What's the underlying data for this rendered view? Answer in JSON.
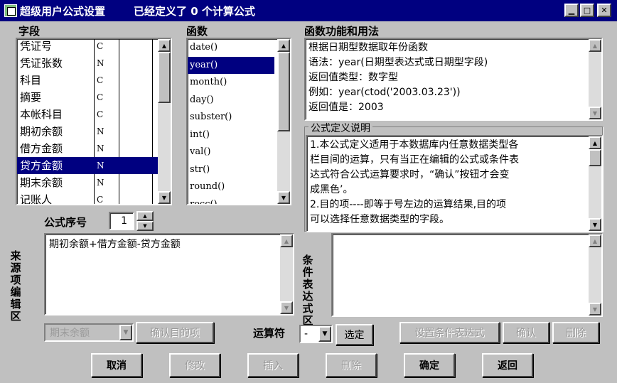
{
  "window": {
    "title": "超级用户公式设置",
    "status": "已经定义了 0 个计算公式",
    "min_glyph": "▁",
    "max_glyph": "□",
    "close_glyph": "✕"
  },
  "fields": {
    "label": "字段",
    "rows": [
      {
        "name": "凭证号",
        "type": "C"
      },
      {
        "name": "凭证张数",
        "type": "N"
      },
      {
        "name": "科目",
        "type": "C"
      },
      {
        "name": "摘要",
        "type": "C"
      },
      {
        "name": "本帐科目",
        "type": "C"
      },
      {
        "name": "期初余额",
        "type": "N"
      },
      {
        "name": "借方金额",
        "type": "N"
      },
      {
        "name": "贷方金额",
        "type": "N"
      },
      {
        "name": "期末余额",
        "type": "N"
      },
      {
        "name": "记账人",
        "type": "C"
      }
    ],
    "selected_index": 7
  },
  "functions": {
    "label": "函数",
    "items": [
      "date()",
      "year()",
      "month()",
      "day()",
      "subster()",
      "int()",
      "val()",
      "str()",
      "round()",
      "recc()"
    ],
    "selected_index": 1
  },
  "usage": {
    "label": "函数功能和用法",
    "lines": [
      "根据日期型数据取年份函数",
      "语法：year(日期型表达式或日期型字段)",
      "返回值类型：数字型",
      "例如：year(ctod('2003.03.23'))",
      "返回值是：2003"
    ]
  },
  "definition": {
    "label": "公式定义说明",
    "lines": [
      "1.本公式定义适用于本数据库内任意数据类型各",
      "栏目间的运算，只有当正在编辑的公式或条件表",
      "达式符合公式运算要求时，“确认”按钮才会变",
      "成黑色’。",
      "2.目的项----即等于号左边的运算结果,目的项",
      "可以选择任意数据类型的字段。"
    ]
  },
  "formula_seq": {
    "label": "公式序号",
    "value": "1"
  },
  "source": {
    "label": "来源项编辑区",
    "text": "期初余额+借方金额-贷方金额"
  },
  "condition": {
    "label": "条件表达式区",
    "text": ""
  },
  "target_combo": {
    "value": "期末余额"
  },
  "operator": {
    "label": "运算符",
    "value": "-"
  },
  "buttons": {
    "confirm_target": "确认目的项",
    "select": "选定",
    "set_condition": "设置条件表达式",
    "confirm": "确认",
    "delete": "删除",
    "cancel": "取消",
    "modify": "修改",
    "insert": "插入",
    "delete2": "删除",
    "ok": "确定",
    "back": "返回"
  },
  "colors": {
    "title_bg": "#000080",
    "face": "#c0c0c0",
    "selection": "#000080"
  }
}
